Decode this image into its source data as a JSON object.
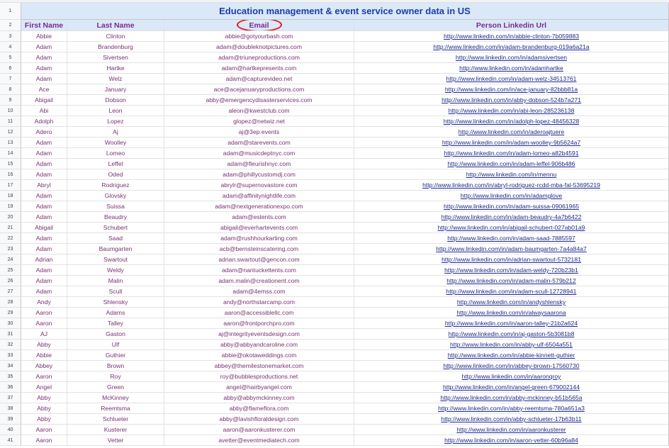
{
  "sheet": {
    "title": "Education management & event service owner data in US",
    "headers": {
      "first_name": "First Name",
      "last_name": "Last Name",
      "email": "Email",
      "linkedin": "Person Linkedin Url"
    },
    "row_numbers": {
      "title": "1",
      "header": "2"
    },
    "rows": [
      {
        "n": "3",
        "first": "Abbie",
        "last": "Clinton",
        "email": "abbie@gotyourbash.com",
        "url": "http://www.linkedin.com/in/abbie-clinton-7b059883"
      },
      {
        "n": "4",
        "first": "Adam",
        "last": "Brandenburg",
        "email": "adam@doubleknotpictures.com",
        "url": "http://www.linkedin.com/in/adam-brandenburg-019a6a21a"
      },
      {
        "n": "5",
        "first": "Adam",
        "last": "Sivertsen",
        "email": "adam@triuneproductions.com",
        "url": "http://www.linkedin.com/in/adamsivertsen"
      },
      {
        "n": "6",
        "first": "Adam",
        "last": "Hartke",
        "email": "adam@hartkepresents.com",
        "url": "http://www.linkedin.com/in/adamhartke"
      },
      {
        "n": "7",
        "first": "Adam",
        "last": "Welz",
        "email": "adam@capturevideo.net",
        "url": "http://www.linkedin.com/in/adam-welz-34513761"
      },
      {
        "n": "8",
        "first": "Ace",
        "last": "January",
        "email": "ace@acejanuaryproductions.com",
        "url": "http://www.linkedin.com/in/ace-january-82bbb81a"
      },
      {
        "n": "9",
        "first": "Abigail",
        "last": "Dobson",
        "email": "abby@emergencydisasterservices.com",
        "url": "http://www.linkedin.com/in/abby-dobson-524b7a271"
      },
      {
        "n": "10",
        "first": "Abi",
        "last": "Leon",
        "email": "aleon@kwestclub.com",
        "url": "http://www.linkedin.com/in/abi-leon-285236138"
      },
      {
        "n": "11",
        "first": "Adolph",
        "last": "Lopez",
        "email": "glopez@netwiz.net",
        "url": "http://www.linkedin.com/in/adolph-lopez-48456328"
      },
      {
        "n": "12",
        "first": "Adero",
        "last": "Aj",
        "email": "aj@3ep.events",
        "url": "http://www.linkedin.com/in/aderoajtuere"
      },
      {
        "n": "13",
        "first": "Adam",
        "last": "Woolley",
        "email": "adam@starevents.com",
        "url": "http://www.linkedin.com/in/adam-woolley-9b5624a7"
      },
      {
        "n": "14",
        "first": "Adam",
        "last": "Lomeo",
        "email": "adam@musicdeptnyc.com",
        "url": "http://www.linkedin.com/in/adam-lomeo-a82b4591"
      },
      {
        "n": "15",
        "first": "Adam",
        "last": "Leffel",
        "email": "adam@fleurishnyc.com",
        "url": "http://www.linkedin.com/in/adam-leffel-906b486"
      },
      {
        "n": "16",
        "first": "Adam",
        "last": "Oded",
        "email": "adam@phillycustomdj.com",
        "url": "http://www.linkedin.com/in/mennu"
      },
      {
        "n": "17",
        "first": "Abryl",
        "last": "Rodriguez",
        "email": "abrylr@supernovastore.com",
        "url": "http://www.linkedin.com/in/abryl-rodriguez-rcdd-mba-fal-53695219"
      },
      {
        "n": "18",
        "first": "Adam",
        "last": "Glovsky",
        "email": "adam@affinitynightlife.com",
        "url": "http://www.linkedin.com/in/adamglove"
      },
      {
        "n": "19",
        "first": "Adam",
        "last": "Suissa",
        "email": "adam@nextgenerationexpo.com",
        "url": "http://www.linkedin.com/in/adam-suissa-09061965"
      },
      {
        "n": "20",
        "first": "Adam",
        "last": "Beaudry",
        "email": "adam@estents.com",
        "url": "http://www.linkedin.com/in/adam-beaudry-4a7b6422"
      },
      {
        "n": "21",
        "first": "Abigail",
        "last": "Schubert",
        "email": "abigail@everhartevents.com",
        "url": "http://www.linkedin.com/in/abigail-schubert-027ab01a9"
      },
      {
        "n": "22",
        "first": "Adam",
        "last": "Saad",
        "email": "adam@rushhourkarting.com",
        "url": "http://www.linkedin.com/in/adam-saad-7885597"
      },
      {
        "n": "23",
        "first": "Adam",
        "last": "Baumgarten",
        "email": "acb@bernsteinscatering.com",
        "url": "http://www.linkedin.com/in/adam-baumgarten-7a4a84a7"
      },
      {
        "n": "24",
        "first": "Adrian",
        "last": "Swartout",
        "email": "adrian.swartout@gencon.com",
        "url": "http://www.linkedin.com/in/adrian-swartout-5732181"
      },
      {
        "n": "25",
        "first": "Adam",
        "last": "Weldy",
        "email": "adam@nantuckettents.com",
        "url": "http://www.linkedin.com/in/adam-weldy-720b23b1"
      },
      {
        "n": "26",
        "first": "Adam",
        "last": "Malin",
        "email": "adam.malin@creationent.com",
        "url": "http://www.linkedin.com/in/adam-malin-579b212"
      },
      {
        "n": "27",
        "first": "Adam",
        "last": "Scull",
        "email": "adam@4emss.com",
        "url": "http://www.linkedin.com/in/adam-scull-12728941"
      },
      {
        "n": "28",
        "first": "Andy",
        "last": "Shlensky",
        "email": "andy@northstarcamp.com",
        "url": "http://www.linkedin.com/in/andyshlensky"
      },
      {
        "n": "29",
        "first": "Aaron",
        "last": "Adams",
        "email": "aaron@accessiblellc.com",
        "url": "http://www.linkedin.com/in/alwaysaarona"
      },
      {
        "n": "30",
        "first": "Aaron",
        "last": "Talley",
        "email": "aaron@frontporchpro.com",
        "url": "http://www.linkedin.com/in/aaron-talley-21b2a624"
      },
      {
        "n": "31",
        "first": "AJ",
        "last": "Gaston",
        "email": "aj@integrityeventsdesign.com",
        "url": "http://www.linkedin.com/in/aj-gaston-5b3081b8"
      },
      {
        "n": "32",
        "first": "Abby",
        "last": "Ulf",
        "email": "abby@abbyandcaroline.com",
        "url": "http://www.linkedin.com/in/abby-ulf-6504a551"
      },
      {
        "n": "33",
        "first": "Abbie",
        "last": "Guthier",
        "email": "abbie@okotaweddings.com",
        "url": "http://www.linkedin.com/in/abbie-kinnett-guthier"
      },
      {
        "n": "34",
        "first": "Abbey",
        "last": "Brown",
        "email": "abbey@themilestonemarket.com",
        "url": "http://www.linkedin.com/in/abbey-brown-17560730"
      },
      {
        "n": "35",
        "first": "Aaron",
        "last": "Roy",
        "email": "roy@bubblesproductions.net",
        "url": "http://www.linkedin.com/in/aaronqroy"
      },
      {
        "n": "36",
        "first": "Angel",
        "last": "Green",
        "email": "angel@hairbyangel.com",
        "url": "http://www.linkedin.com/in/angel-green-679002144"
      },
      {
        "n": "37",
        "first": "Abby",
        "last": "McKinney",
        "email": "abby@abbymckinney.com",
        "url": "http://www.linkedin.com/in/abby-mckinney-b51b565a"
      },
      {
        "n": "38",
        "first": "Abby",
        "last": "Reemtsma",
        "email": "abby@flameflora.com",
        "url": "http://www.linkedin.com/in/abby-reemtsma-780a651a3"
      },
      {
        "n": "39",
        "first": "Abby",
        "last": "Schlueter",
        "email": "abby@lavishfloraldesign.com",
        "url": "http://www.linkedin.com/in/abby-schlueter-17b63b11"
      },
      {
        "n": "40",
        "first": "Aaron",
        "last": "Kusterer",
        "email": "aaron@aaronkusterer.com",
        "url": "http://www.linkedin.com/in/aaronkusterer"
      },
      {
        "n": "41",
        "first": "Aaron",
        "last": "Vetter",
        "email": "avetter@eventmediatech.com",
        "url": "http://www.linkedin.com/in/aaron-vetter-60b96a84"
      }
    ]
  },
  "colors": {
    "header_bg": "#dae8f8",
    "title_text": "#1c3ea8",
    "header_text": "#7d2a8c",
    "data_text": "#7b2f73",
    "link_text": "#1f2a8a",
    "annotation_circle": "#e01b24"
  }
}
